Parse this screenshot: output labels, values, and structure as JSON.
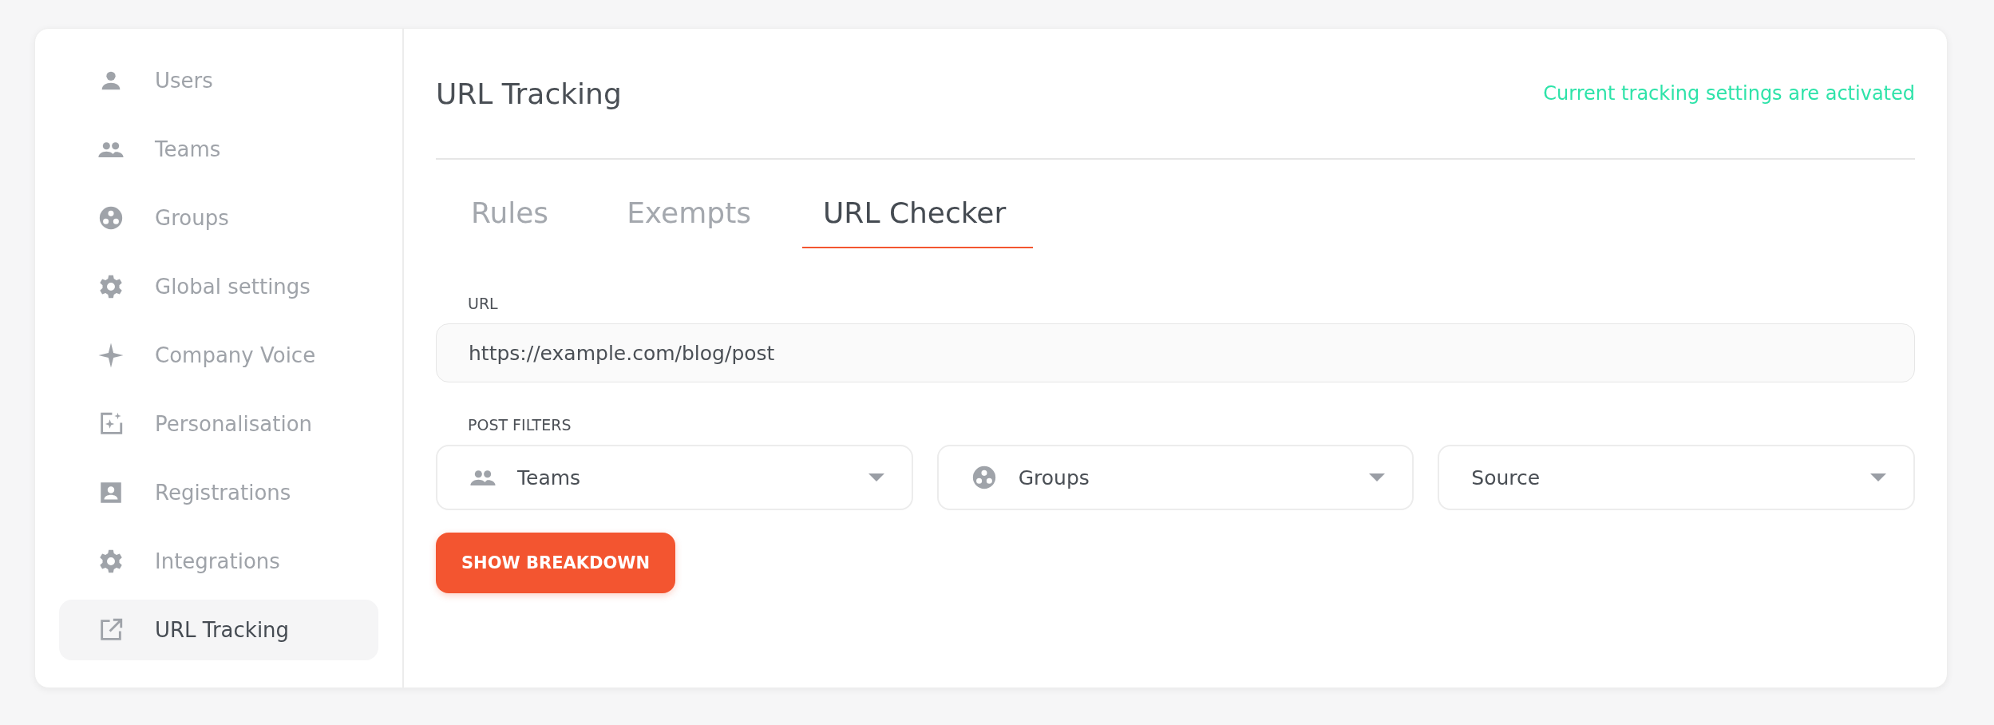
{
  "sidebar": {
    "items": [
      {
        "label": "Users",
        "kind": "person",
        "selected": false
      },
      {
        "label": "Teams",
        "kind": "people",
        "selected": false
      },
      {
        "label": "Groups",
        "kind": "groups",
        "selected": false
      },
      {
        "label": "Global settings",
        "kind": "gear",
        "selected": false
      },
      {
        "label": "Company Voice",
        "kind": "sparkle",
        "selected": false
      },
      {
        "label": "Personalisation",
        "kind": "photo",
        "selected": false
      },
      {
        "label": "Registrations",
        "kind": "contact",
        "selected": false
      },
      {
        "label": "Integrations",
        "kind": "gear",
        "selected": false
      },
      {
        "label": "URL Tracking",
        "kind": "external",
        "selected": true
      }
    ]
  },
  "header": {
    "title": "URL Tracking",
    "status": "Current tracking settings are activated"
  },
  "tabs": [
    {
      "label": "Rules",
      "selected": false
    },
    {
      "label": "Exempts",
      "selected": false
    },
    {
      "label": "URL Checker",
      "selected": true
    }
  ],
  "url_field": {
    "label": "URL",
    "value": "https://example.com/blog/post"
  },
  "post_filters": {
    "label": "POST FILTERS",
    "dropdowns": [
      {
        "label": "Teams",
        "kind": "people"
      },
      {
        "label": "Groups",
        "kind": "groups"
      },
      {
        "label": "Source",
        "kind": "plain"
      }
    ]
  },
  "button": "SHOW BREAKDOWN"
}
